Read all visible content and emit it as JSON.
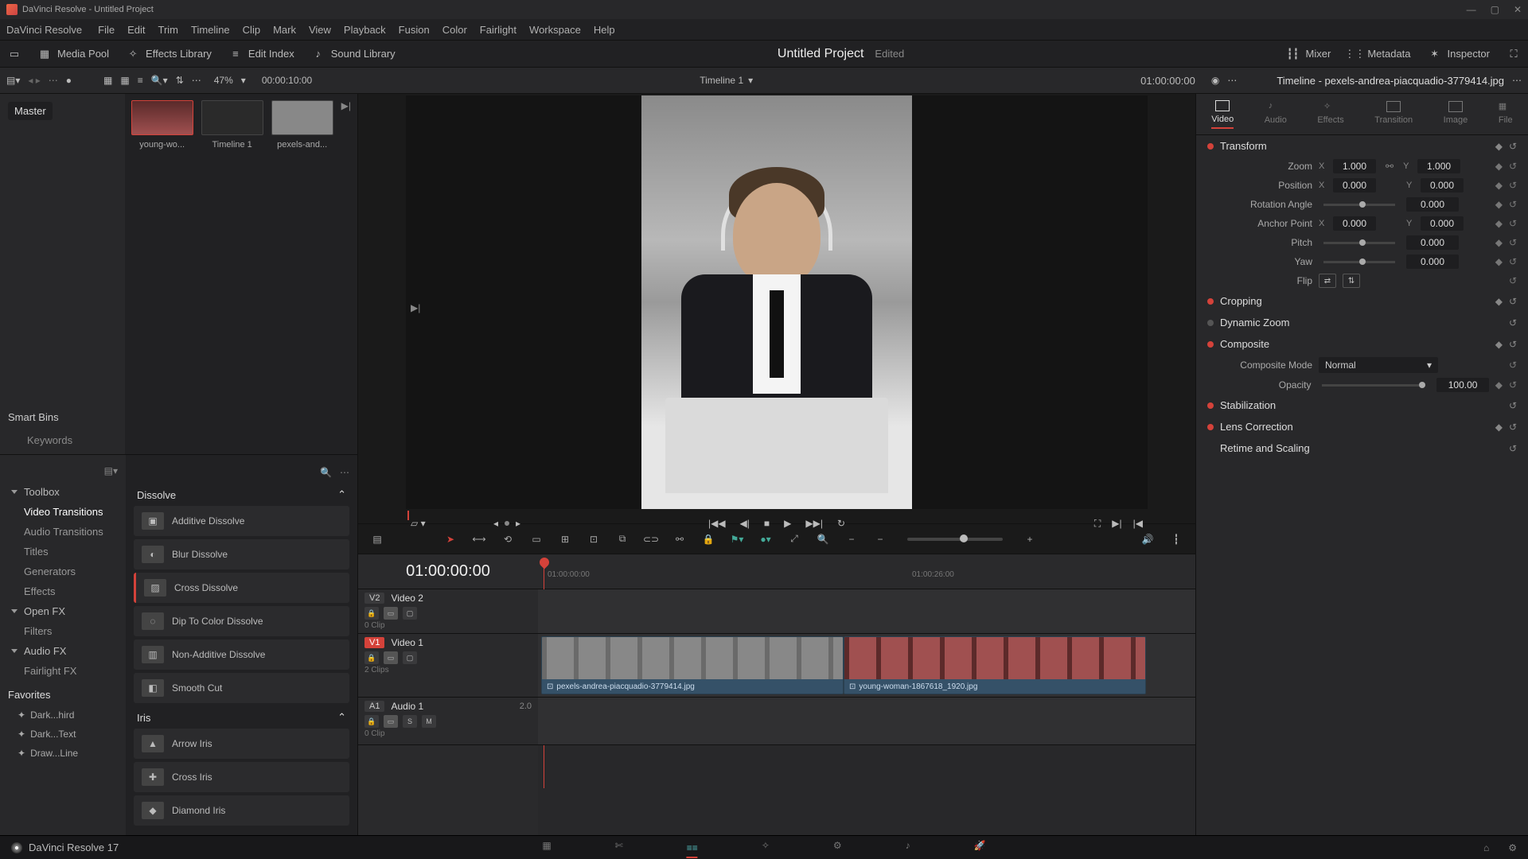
{
  "titlebar": {
    "title": "DaVinci Resolve - Untitled Project"
  },
  "menubar": {
    "brand": "DaVinci Resolve",
    "items": [
      "File",
      "Edit",
      "Trim",
      "Timeline",
      "Clip",
      "Mark",
      "View",
      "Playback",
      "Fusion",
      "Color",
      "Fairlight",
      "Workspace",
      "Help"
    ]
  },
  "secbar": {
    "media_pool": "Media Pool",
    "effects_library": "Effects Library",
    "edit_index": "Edit Index",
    "sound_library": "Sound Library",
    "project_title": "Untitled Project",
    "edited": "Edited",
    "mixer": "Mixer",
    "metadata": "Metadata",
    "inspector": "Inspector"
  },
  "toolbar2": {
    "zoom": "47%",
    "tc_left": "00:00:10:00",
    "timeline_name": "Timeline 1",
    "tc_right": "01:00:00:00"
  },
  "media": {
    "master": "Master",
    "smart_bins": "Smart Bins",
    "keywords": "Keywords",
    "thumbs": [
      {
        "label": "young-wo..."
      },
      {
        "label": "Timeline 1"
      },
      {
        "label": "pexels-and..."
      }
    ]
  },
  "fx": {
    "nav": {
      "toolbox": "Toolbox",
      "video_transitions": "Video Transitions",
      "audio_transitions": "Audio Transitions",
      "titles": "Titles",
      "generators": "Generators",
      "effects": "Effects",
      "open_fx": "Open FX",
      "filters": "Filters",
      "audio_fx": "Audio FX",
      "fairlight_fx": "Fairlight FX",
      "favorites": "Favorites",
      "fav_items": [
        "Dark...hird",
        "Dark...Text",
        "Draw...Line"
      ]
    },
    "dissolve_head": "Dissolve",
    "dissolve": [
      "Additive Dissolve",
      "Blur Dissolve",
      "Cross Dissolve",
      "Dip To Color Dissolve",
      "Non-Additive Dissolve",
      "Smooth Cut"
    ],
    "iris_head": "Iris",
    "iris": [
      "Arrow Iris",
      "Cross Iris",
      "Diamond Iris"
    ]
  },
  "timeline": {
    "bigtc": "01:00:00:00",
    "ruler": {
      "t0": "01:00:00:00",
      "t1": "01:00:26:00"
    },
    "tracks": {
      "v2": {
        "badge": "V2",
        "name": "Video 2",
        "clips": "0 Clip"
      },
      "v1": {
        "badge": "V1",
        "name": "Video 1",
        "clips": "2 Clips"
      },
      "a1": {
        "badge": "A1",
        "name": "Audio 1",
        "chan": "2.0",
        "clips": "0 Clip",
        "s": "S",
        "m": "M"
      }
    },
    "clips": {
      "c1": "pexels-andrea-piacquadio-3779414.jpg",
      "c2": "young-woman-1867618_1920.jpg"
    }
  },
  "inspector": {
    "title": "Timeline - pexels-andrea-piacquadio-3779414.jpg",
    "tabs": {
      "video": "Video",
      "audio": "Audio",
      "effects": "Effects",
      "transition": "Transition",
      "image": "Image",
      "file": "File"
    },
    "transform": {
      "head": "Transform",
      "zoom_lbl": "Zoom",
      "zoom_x": "1.000",
      "zoom_y": "1.000",
      "pos_lbl": "Position",
      "pos_x": "0.000",
      "pos_y": "0.000",
      "rot_lbl": "Rotation Angle",
      "rot": "0.000",
      "anchor_lbl": "Anchor Point",
      "anchor_x": "0.000",
      "anchor_y": "0.000",
      "pitch_lbl": "Pitch",
      "pitch": "0.000",
      "yaw_lbl": "Yaw",
      "yaw": "0.000",
      "flip_lbl": "Flip"
    },
    "cropping": "Cropping",
    "dynamic_zoom": "Dynamic Zoom",
    "composite": {
      "head": "Composite",
      "mode_lbl": "Composite Mode",
      "mode": "Normal",
      "opacity_lbl": "Opacity",
      "opacity": "100.00"
    },
    "stabilization": "Stabilization",
    "lens": "Lens Correction",
    "retime": "Retime and Scaling"
  },
  "bottombar": {
    "brand": "DaVinci Resolve 17"
  }
}
